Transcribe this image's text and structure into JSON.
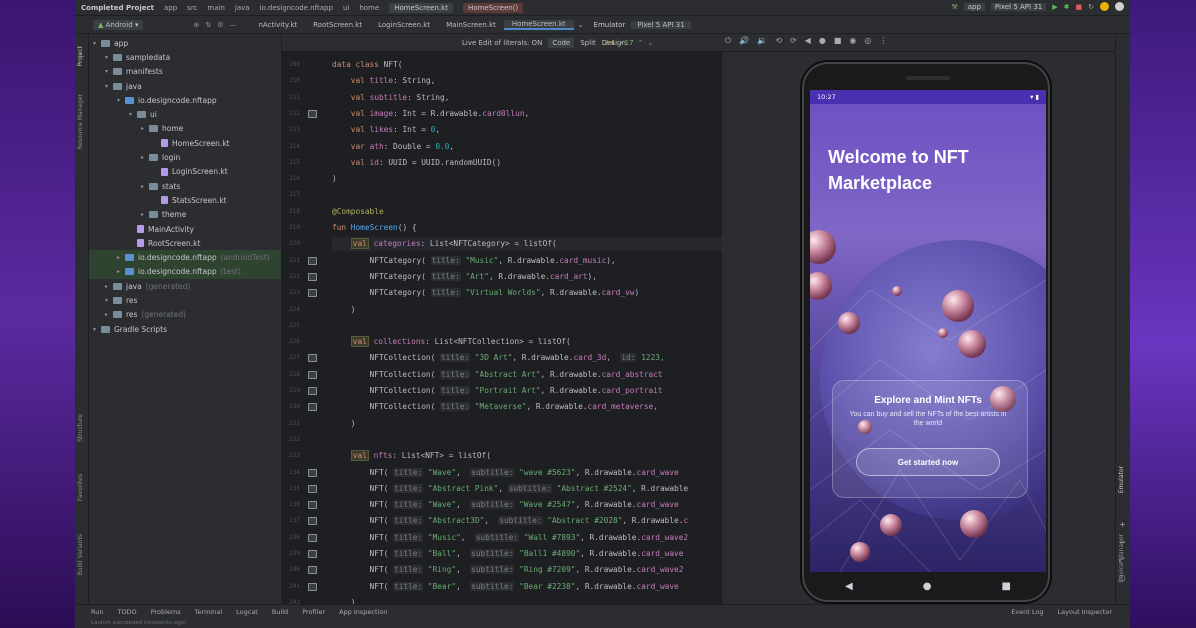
{
  "window": {
    "project": "Completed Project",
    "breadcrumb": [
      "app",
      "src",
      "main",
      "java",
      "io.designcode.nftapp",
      "ui",
      "home"
    ],
    "open_file_title": "HomeScreen.kt",
    "title_tabs": [
      "HomeScreen.kt",
      "HomeScreen()"
    ],
    "run_config": "app",
    "device": "Pixel 5 API 31"
  },
  "tabs": {
    "view_selector": "Android",
    "files": [
      "nActivity.kt",
      "RootScreen.kt",
      "LoginScreen.kt",
      "MainScreen.kt",
      "HomeScreen.kt"
    ],
    "emulator_label": "Emulator",
    "emulator_device": "Pixel 5 API 31"
  },
  "side_labels": {
    "project": "Project",
    "resource_manager": "Resource Manager",
    "structure": "Structure",
    "favorites": "Favorites",
    "build_variants": "Build Variants",
    "emulator": "Emulator",
    "device_manager": "Device Manager"
  },
  "editor_toolbar": {
    "live_edit": "Live Edit of literals: ON",
    "code": "Code",
    "split": "Split",
    "design": "Design",
    "warnings": "4",
    "checks": "17"
  },
  "tree": [
    {
      "label": "app",
      "depth": 0,
      "type": "folder"
    },
    {
      "label": "sampledata",
      "depth": 1,
      "type": "folder"
    },
    {
      "label": "manifests",
      "depth": 1,
      "type": "folder"
    },
    {
      "label": "java",
      "depth": 1,
      "type": "folder"
    },
    {
      "label": "io.designcode.nftapp",
      "depth": 2,
      "type": "folder"
    },
    {
      "label": "ui",
      "depth": 3,
      "type": "folder"
    },
    {
      "label": "home",
      "depth": 4,
      "type": "folder"
    },
    {
      "label": "HomeScreen.kt",
      "depth": 5,
      "type": "file"
    },
    {
      "label": "login",
      "depth": 4,
      "type": "folder"
    },
    {
      "label": "LoginScreen.kt",
      "depth": 5,
      "type": "file"
    },
    {
      "label": "stats",
      "depth": 4,
      "type": "folder"
    },
    {
      "label": "StatsScreen.kt",
      "depth": 5,
      "type": "file"
    },
    {
      "label": "theme",
      "depth": 4,
      "type": "folder"
    },
    {
      "label": "MainActivity",
      "depth": 3,
      "type": "file"
    },
    {
      "label": "RootScreen.kt",
      "depth": 3,
      "type": "file"
    },
    {
      "label": "io.designcode.nftapp",
      "depth": 2,
      "type": "folder",
      "suffix": "(androidTest)",
      "selected": true
    },
    {
      "label": "io.designcode.nftapp",
      "depth": 2,
      "type": "folder",
      "suffix": "(test)",
      "selected": true
    },
    {
      "label": "java",
      "depth": 1,
      "type": "folder",
      "suffix": "(generated)"
    },
    {
      "label": "res",
      "depth": 1,
      "type": "folder"
    },
    {
      "label": "res",
      "depth": 1,
      "type": "folder",
      "suffix": "(generated)"
    },
    {
      "label": "Gradle Scripts",
      "depth": 0,
      "type": "folder"
    }
  ],
  "code_lines": [
    {
      "n": "209",
      "html": "<span class='kw'>data class</span> NFT("
    },
    {
      "n": "210",
      "html": "    <span class='kw'>val</span> <span class='prop'>title</span>: String,"
    },
    {
      "n": "211",
      "html": "    <span class='kw'>val</span> <span class='prop'>subtitle</span>: String,"
    },
    {
      "n": "212",
      "html": "    <span class='kw'>val</span> <span class='prop'>image</span>: Int = R.drawable.<span class='prop'>card0llun</span>,"
    },
    {
      "n": "213",
      "html": "    <span class='kw'>val</span> <span class='prop'>likes</span>: Int = <span class='num'>0</span>,"
    },
    {
      "n": "214",
      "html": "    <span class='kw'>var</span> <span class='prop'>ath</span>: Double = <span class='num'>0.0</span>,"
    },
    {
      "n": "215",
      "html": "    <span class='kw'>val</span> <span class='prop'>id</span>: UUID = UUID.randomUUID()"
    },
    {
      "n": "216",
      "html": ")"
    },
    {
      "n": "217",
      "html": ""
    },
    {
      "n": "218",
      "html": "<span class='ann'>@Composable</span>"
    },
    {
      "n": "219",
      "html": "<span class='kw'>fun</span> <span class='fn'>HomeScreen</span>() {"
    },
    {
      "n": "220",
      "html": "    <span class='vbox'>val</span> <span class='prop'>categories</span>: List&lt;NFTCategory&gt; = listOf(",
      "hl": true
    },
    {
      "n": "221",
      "html": "        NFTCategory( <span class='hint'>title:</span> <span class='str'>\"Music\"</span>, R.drawable.<span class='prop'>card_music</span>),"
    },
    {
      "n": "222",
      "html": "        NFTCategory( <span class='hint'>title:</span> <span class='str'>\"Art\"</span>, R.drawable.<span class='prop'>card_art</span>),"
    },
    {
      "n": "223",
      "html": "        NFTCategory( <span class='hint'>title:</span> <span class='str'>\"Virtual Worlds\"</span>, R.drawable.<span class='prop'>card_vw</span>)"
    },
    {
      "n": "224",
      "html": "    )"
    },
    {
      "n": "225",
      "html": ""
    },
    {
      "n": "226",
      "html": "    <span class='vbox'>val</span> <span class='prop'>collections</span>: List&lt;NFTCollection&gt; = listOf("
    },
    {
      "n": "227",
      "html": "        NFTCollection( <span class='hint'>title:</span> <span class='str'>\"3D Art\"</span>, R.drawable.<span class='prop'>card_3d</span>,  <span class='hint'>id:</span> <span class='str'>1223,</span>"
    },
    {
      "n": "228",
      "html": "        NFTCollection( <span class='hint'>title:</span> <span class='str'>\"Abstract Art\"</span>, R.drawable.<span class='prop'>card_abstract</span>"
    },
    {
      "n": "229",
      "html": "        NFTCollection( <span class='hint'>title:</span> <span class='str'>\"Portrait Art\"</span>, R.drawable.<span class='prop'>card_portrait</span>"
    },
    {
      "n": "230",
      "html": "        NFTCollection( <span class='hint'>title:</span> <span class='str'>\"Metaverse\"</span>, R.drawable.<span class='prop'>card_metaverse</span>,"
    },
    {
      "n": "231",
      "html": "    )"
    },
    {
      "n": "232",
      "html": ""
    },
    {
      "n": "233",
      "html": "    <span class='vbox'>val</span> <span class='prop'>nfts</span>: List&lt;NFT&gt; = listOf("
    },
    {
      "n": "234",
      "html": "        NFT( <span class='hint'>title:</span> <span class='str'>\"Wave\"</span>,  <span class='hint'>subtitle:</span> <span class='str'>\"wave #5623\"</span>, R.drawable.<span class='prop'>card_wave</span>"
    },
    {
      "n": "235",
      "html": "        NFT( <span class='hint'>title:</span> <span class='str'>\"Abstract Pink\"</span>, <span class='hint'>subtitle:</span> <span class='str'>\"Abstract #2524\"</span>, R.drawable"
    },
    {
      "n": "236",
      "html": "        NFT( <span class='hint'>title:</span> <span class='str'>\"Wave\"</span>,  <span class='hint'>subtitle:</span> <span class='str'>\"Wave #2547\"</span>, R.drawable.<span class='prop'>card_wave</span>"
    },
    {
      "n": "237",
      "html": "        NFT( <span class='hint'>title:</span> <span class='str'>\"Abstract3D\"</span>,  <span class='hint'>subtitle:</span> <span class='str'>\"Abstract #2028\"</span>, R.drawable.<span class='prop'>c</span>"
    },
    {
      "n": "238",
      "html": "        NFT( <span class='hint'>title:</span> <span class='str'>\"Music\"</span>,  <span class='hint'>subtitle:</span> <span class='str'>\"Wall #7893\"</span>, R.drawable.<span class='prop'>card_wave2</span>"
    },
    {
      "n": "239",
      "html": "        NFT( <span class='hint'>title:</span> <span class='str'>\"Ball\"</span>,  <span class='hint'>subtitle:</span> <span class='str'>\"Ball1 #4890\"</span>, R.drawable.<span class='prop'>card_wave</span>"
    },
    {
      "n": "240",
      "html": "        NFT( <span class='hint'>title:</span> <span class='str'>\"Ring\"</span>,  <span class='hint'>subtitle:</span> <span class='str'>\"Ring #7209\"</span>, R.drawable.<span class='prop'>card_wave2</span>"
    },
    {
      "n": "241",
      "html": "        NFT( <span class='hint'>title:</span> <span class='str'>\"Bear\"</span>,  <span class='hint'>subtitle:</span> <span class='str'>\"Bear #2238\"</span>, R.drawable.<span class='prop'>card_wave</span>"
    },
    {
      "n": "242",
      "html": "    )"
    }
  ],
  "phone": {
    "time": "10:27",
    "headline_1": "Welcome to NFT",
    "headline_2": "Marketplace",
    "card_title": "Explore and Mint NFTs",
    "card_sub": "You can buy and sell the NFTs of the best artists in the world",
    "cta": "Get started now",
    "nav_back": "◀",
    "nav_home": "●",
    "nav_recent": "■"
  },
  "bottom": {
    "tools": [
      "Run",
      "TODO",
      "Problems",
      "Terminal",
      "Logcat",
      "Build",
      "Profiler",
      "App Inspection"
    ],
    "right_tools": [
      "Event Log",
      "Layout Inspector"
    ],
    "status": "Launch succeeded (moments ago)"
  },
  "colors": {
    "accent": "#4a2fb0",
    "bg": "#2b2d30",
    "editor_bg": "#1e1f22"
  }
}
